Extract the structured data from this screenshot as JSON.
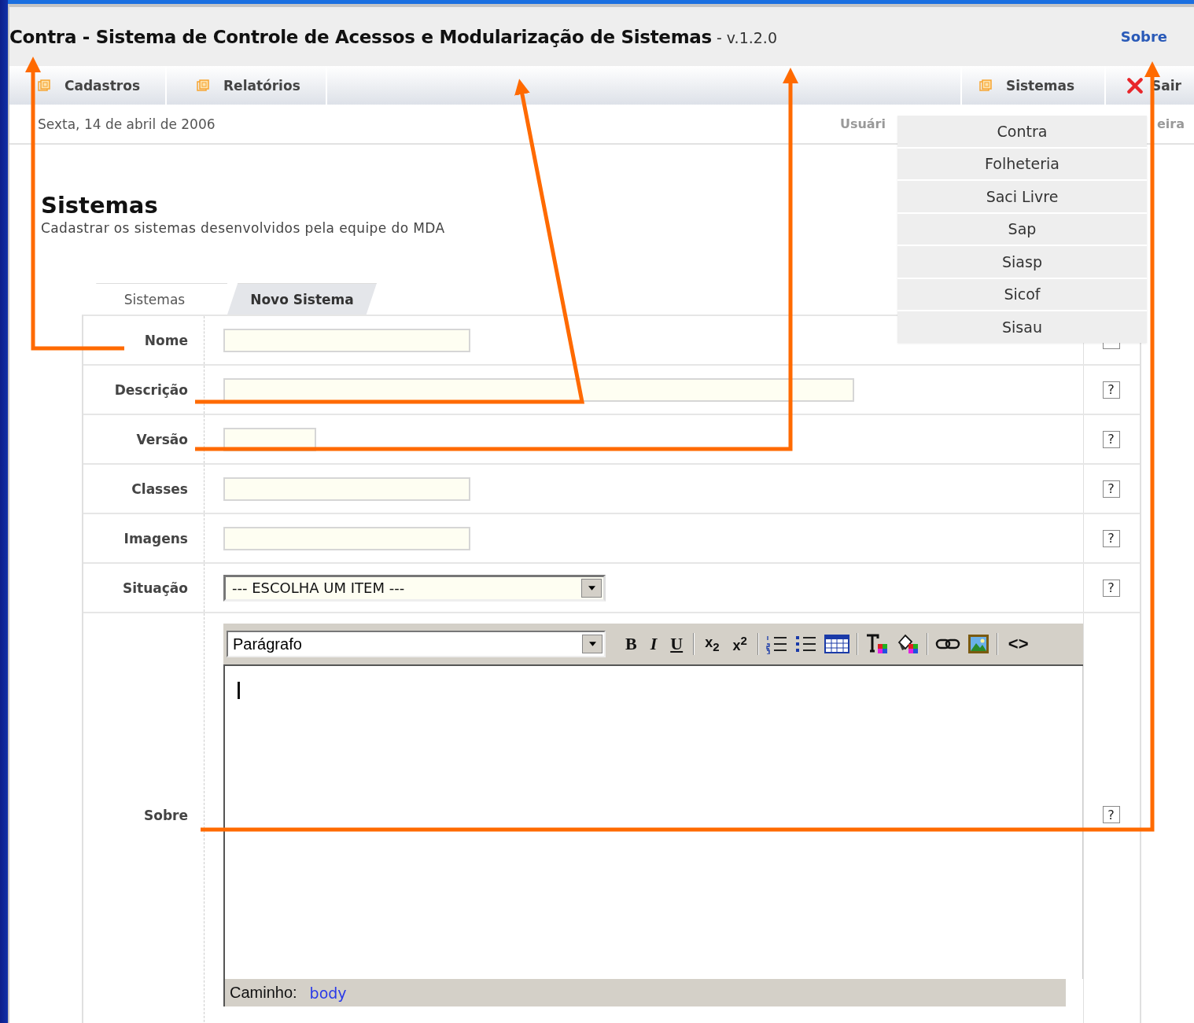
{
  "header": {
    "title": "Contra - Sistema de Controle de Acessos e Modularização de Sistemas",
    "version": "- v.1.2.0",
    "about_link": "Sobre"
  },
  "menu": {
    "left": [
      {
        "label": "Cadastros",
        "kind": "folder"
      },
      {
        "label": "Relatórios",
        "kind": "folder"
      }
    ],
    "right": [
      {
        "label": "Sistemas",
        "kind": "folder"
      },
      {
        "label": "Sair",
        "kind": "exit"
      }
    ]
  },
  "info_bar": {
    "date": "Sexta, 14 de abril de 2006",
    "user_left": "Usuári",
    "user_right": "eira"
  },
  "systems_menu": [
    "Contra",
    "Folheteria",
    "Saci Livre",
    "Sap",
    "Siasp",
    "Sicof",
    "Sisau"
  ],
  "page": {
    "title": "Sistemas",
    "subtitle": "Cadastrar os sistemas desenvolvidos pela equipe do MDA"
  },
  "tabs": [
    {
      "label": "Sistemas",
      "selected": false
    },
    {
      "label": "Novo Sistema",
      "selected": true
    }
  ],
  "form": {
    "rows": [
      {
        "label": "Nome",
        "kind": "medium"
      },
      {
        "label": "Descrição",
        "kind": "long",
        "help": "?"
      },
      {
        "label": "Versão",
        "kind": "short",
        "help": "?"
      },
      {
        "label": "Classes",
        "kind": "medium",
        "help": "?"
      },
      {
        "label": "Imagens",
        "kind": "medium",
        "help": "?"
      },
      {
        "label": "Situação",
        "kind": "select",
        "value": "--- ESCOLHA UM ITEM ---",
        "help": "?"
      },
      {
        "label": "Sobre",
        "kind": "editor",
        "help": "?"
      }
    ]
  },
  "editor": {
    "format": "Parágrafo",
    "toolbar": [
      [
        {
          "kind": "bold",
          "label": "B"
        },
        {
          "kind": "italic",
          "label": "I"
        },
        {
          "kind": "underline",
          "label": "U"
        }
      ],
      [
        {
          "kind": "script",
          "label": "x$_{2}$"
        },
        {
          "kind": "script",
          "label": "x$^{2}$"
        }
      ],
      [
        {
          "kind": "numbered-list"
        },
        {
          "kind": "bullet-list"
        },
        {
          "kind": "table"
        }
      ],
      [
        {
          "kind": "text-color"
        },
        {
          "kind": "background-color"
        }
      ],
      [
        {
          "kind": "link"
        },
        {
          "kind": "image"
        }
      ],
      [
        {
          "kind": "code",
          "label": "<>"
        }
      ]
    ],
    "path_label": "Caminho:",
    "path": "body"
  }
}
